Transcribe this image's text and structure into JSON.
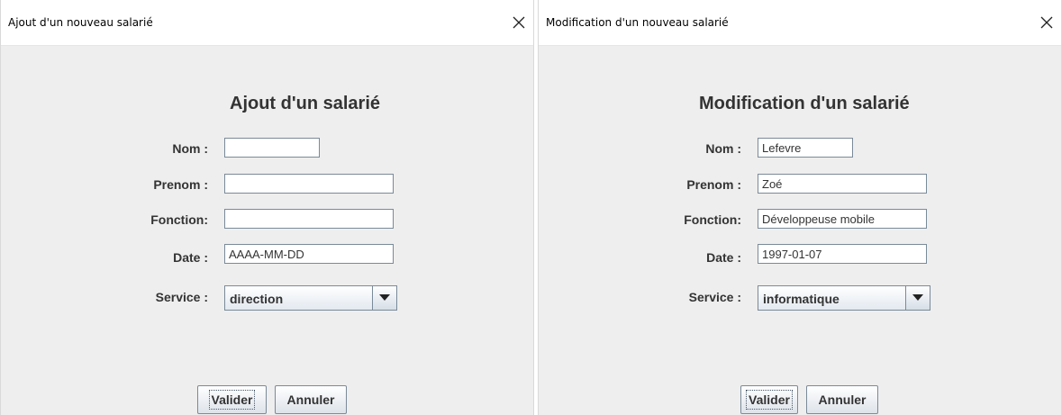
{
  "add_dialog": {
    "window_title": "Ajout d'un nouveau salarié",
    "close_icon": "close-icon",
    "heading": "Ajout d'un salarié",
    "labels": {
      "nom": "Nom :",
      "prenom": "Prenom :",
      "fonction": "Fonction:",
      "date": "Date :",
      "service": "Service :"
    },
    "fields": {
      "nom": "",
      "prenom": "",
      "fonction": "",
      "date": "AAAA-MM-DD"
    },
    "service": {
      "selected": "direction",
      "dropdown_icon": "chevron-down-icon"
    },
    "buttons": {
      "validate": "Valider",
      "cancel": "Annuler"
    }
  },
  "edit_dialog": {
    "window_title": "Modification d'un nouveau salarié",
    "close_icon": "close-icon",
    "heading": "Modification d'un salarié",
    "labels": {
      "nom": "Nom :",
      "prenom": "Prenom :",
      "fonction": "Fonction:",
      "date": "Date :",
      "service": "Service :"
    },
    "fields": {
      "nom": "Lefevre",
      "prenom": "Zoé",
      "fonction": "Développeuse mobile",
      "date": "1997-01-07"
    },
    "service": {
      "selected": "informatique",
      "dropdown_icon": "chevron-down-icon"
    },
    "buttons": {
      "validate": "Valider",
      "cancel": "Annuler"
    }
  },
  "colors": {
    "dialog_bg": "#eeeeee",
    "text": "#333333",
    "field_border": "#7a8a99",
    "titlebar_bg": "#ffffff"
  }
}
